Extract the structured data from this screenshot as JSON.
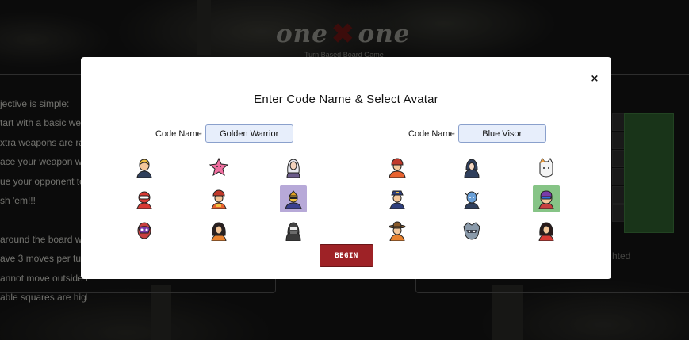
{
  "app": {
    "logo_left": "one",
    "logo_mid": "✖",
    "logo_right": "one",
    "tagline": "Turn Based Board Game"
  },
  "rules": {
    "lines": [
      "jective is simple:",
      "tart with a basic wea",
      "xtra weapons are ra",
      "ace your weapon with",
      "ue your opponent to t",
      "sh 'em!!!",
      "",
      "around the board wit",
      "ave 3 moves per turn",
      "annot move outside t",
      "able squares are high"
    ]
  },
  "right_panel": {
    "note": "hted"
  },
  "modal": {
    "title": "Enter Code Name & Select Avatar",
    "close_label": "×",
    "begin_label": "BEGIN",
    "players": [
      {
        "code_label": "Code Name",
        "code_value": "Golden Warrior",
        "avatars": [
          {
            "name": "blonde-man-avatar",
            "selected": false
          },
          {
            "name": "starfish-avatar",
            "selected": false
          },
          {
            "name": "white-hair-woman-avatar",
            "selected": false
          },
          {
            "name": "red-masked-hero-avatar",
            "selected": false
          },
          {
            "name": "firefighter-woman-avatar",
            "selected": false
          },
          {
            "name": "golden-warrior-avatar",
            "selected": true
          },
          {
            "name": "luchador-mask-avatar",
            "selected": false
          },
          {
            "name": "dark-hair-woman-avatar",
            "selected": false
          },
          {
            "name": "hooded-assassin-avatar",
            "selected": false
          }
        ],
        "selected_color": "#b7a9d8"
      },
      {
        "code_label": "Code Name",
        "code_value": "Blue Visor",
        "avatars": [
          {
            "name": "red-helmet-avatar",
            "selected": false
          },
          {
            "name": "dark-hooded-avatar",
            "selected": false
          },
          {
            "name": "white-cat-avatar",
            "selected": false
          },
          {
            "name": "pilot-avatar",
            "selected": false
          },
          {
            "name": "blue-alien-avatar",
            "selected": false
          },
          {
            "name": "blue-visor-avatar",
            "selected": true
          },
          {
            "name": "cowboy-avatar",
            "selected": false
          },
          {
            "name": "raccoon-avatar",
            "selected": false
          },
          {
            "name": "red-hair-woman-avatar",
            "selected": false
          }
        ],
        "selected_color": "#86c486"
      }
    ]
  },
  "colors": {
    "begin_button": "#9e2226",
    "input_bg": "#e7eefb",
    "modal_bg": "#ffffff",
    "page_bg": "#151515"
  }
}
